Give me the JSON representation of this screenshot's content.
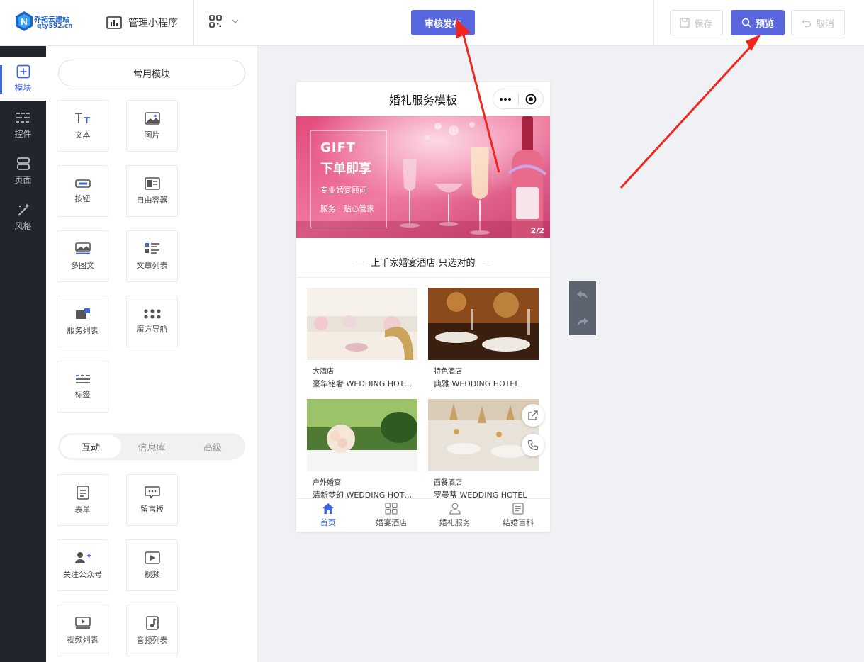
{
  "brand": {
    "name": "乔拓云建站",
    "url": "qty592.cn",
    "accent": "#5867dd"
  },
  "header": {
    "manage_label": "管理小程序",
    "publish_label": "审核发布",
    "save_label": "保存",
    "preview_label": "预览",
    "cancel_label": "取消"
  },
  "rail": {
    "items": [
      {
        "label": "模块",
        "icon": "plus-square-icon"
      },
      {
        "label": "控件",
        "icon": "sliders-icon"
      },
      {
        "label": "页面",
        "icon": "layers-icon"
      },
      {
        "label": "风格",
        "icon": "magic-wand-icon"
      }
    ]
  },
  "panel": {
    "common_title": "常用模块",
    "common": [
      {
        "label": "文本",
        "icon": "text-icon"
      },
      {
        "label": "图片",
        "icon": "image-icon"
      },
      {
        "label": "按钮",
        "icon": "button-icon"
      },
      {
        "label": "自由容器",
        "icon": "container-icon"
      },
      {
        "label": "多图文",
        "icon": "multi-image-icon"
      },
      {
        "label": "文章列表",
        "icon": "article-list-icon"
      },
      {
        "label": "服务列表",
        "icon": "service-list-icon"
      },
      {
        "label": "魔方导航",
        "icon": "grid-nav-icon"
      },
      {
        "label": "标签",
        "icon": "tag-icon"
      }
    ],
    "tabs": [
      "互动",
      "信息库",
      "高级"
    ],
    "interactive": [
      {
        "label": "表单",
        "icon": "form-icon"
      },
      {
        "label": "留言板",
        "icon": "message-board-icon"
      },
      {
        "label": "关注公众号",
        "icon": "follow-icon"
      },
      {
        "label": "视频",
        "icon": "video-icon"
      },
      {
        "label": "视频列表",
        "icon": "video-list-icon"
      },
      {
        "label": "音频列表",
        "icon": "audio-list-icon"
      }
    ]
  },
  "phone": {
    "title": "婚礼服务模板",
    "banner": {
      "gift": "GIFT",
      "headline": "下单即享",
      "line1": "专业婚宴顾问",
      "line2": "服务 · 贴心管家",
      "page": "2/2"
    },
    "section_title": "上千家婚宴酒店 只选对的",
    "cards": [
      {
        "name": "大酒店",
        "sub": "豪华铭奢 WEDDING HOTEL"
      },
      {
        "name": "特色酒店",
        "sub": "典雅 WEDDING HOTEL"
      },
      {
        "name": "户外婚宴",
        "sub": "清新梦幻 WEDDING HOTEL"
      },
      {
        "name": "西餐酒店",
        "sub": "罗曼蒂 WEDDING HOTEL"
      }
    ],
    "tabbar": [
      {
        "label": "首页",
        "icon": "home-icon"
      },
      {
        "label": "婚宴酒店",
        "icon": "grid-icon"
      },
      {
        "label": "婚礼服务",
        "icon": "user-icon"
      },
      {
        "label": "结婚百科",
        "icon": "document-icon"
      }
    ]
  }
}
